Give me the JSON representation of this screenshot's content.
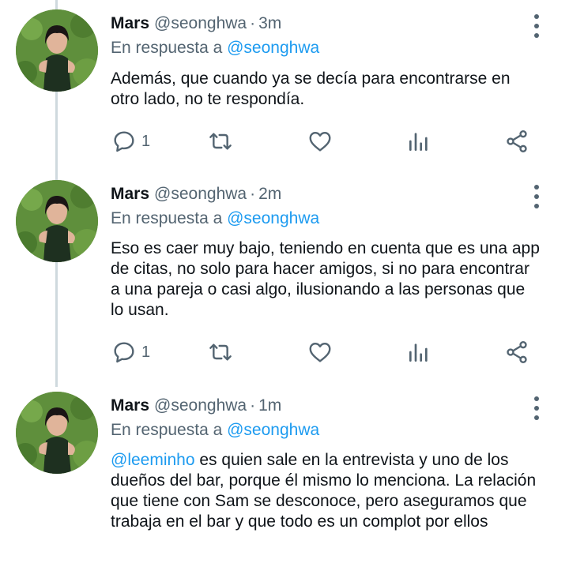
{
  "tweets": [
    {
      "name": "Mars",
      "handle": "@seonghwa",
      "separator": "·",
      "time": "3m",
      "reply_prefix": "En respuesta a",
      "reply_to": "@seonghwa",
      "mention": "",
      "text": "Además, que cuando ya se decía para encontrarse en otro lado, no te respondía.",
      "reply_count": "1"
    },
    {
      "name": "Mars",
      "handle": "@seonghwa",
      "separator": "·",
      "time": "2m",
      "reply_prefix": "En respuesta a",
      "reply_to": "@seonghwa",
      "mention": "",
      "text": "Eso es caer muy bajo, teniendo en cuenta que es una app de citas, no solo para hacer amigos, si no para encontrar a una pareja o casi algo, ilusionando a las personas que lo usan.",
      "reply_count": "1"
    },
    {
      "name": "Mars",
      "handle": "@seonghwa",
      "separator": "·",
      "time": "1m",
      "reply_prefix": "En respuesta a",
      "reply_to": "@seonghwa",
      "mention": "@leeminho",
      "text": " es quien sale en la entrevista y uno de los dueños del bar, porque él mismo lo menciona. La relación que tiene con Sam se desconoce, pero aseguramos que trabaja en el bar y que todo es un complot por ellos",
      "reply_count": ""
    }
  ],
  "icons": {
    "reply": "reply-bubble-icon",
    "retweet": "retweet-icon",
    "like": "heart-icon",
    "views": "bar-chart-icon",
    "share": "share-icon",
    "more": "more-vertical-icon"
  },
  "colors": {
    "link": "#1d9bf0",
    "muted": "#536471",
    "text": "#0f1419",
    "thread_line": "#cfd9de"
  }
}
